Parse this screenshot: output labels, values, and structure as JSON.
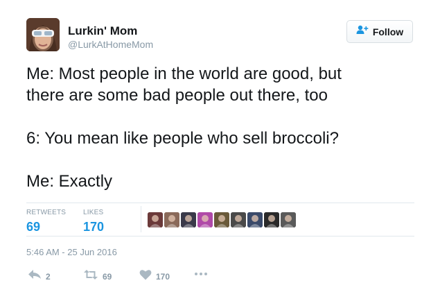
{
  "user": {
    "display_name": "Lurkin' Mom",
    "handle": "@LurkAtHomeMom"
  },
  "follow_button": {
    "label": "Follow",
    "icon": "add-user-icon"
  },
  "tweet": {
    "lines": [
      "Me: Most people in the world are good, but",
      "there are some bad people out there, too",
      "6: You mean like people who sell broccoli?",
      "Me: Exactly"
    ]
  },
  "stats": {
    "retweets_label": "RETWEETS",
    "retweets_value": "69",
    "likes_label": "LIKES",
    "likes_value": "170"
  },
  "likers": {
    "icon": "liker-avatar",
    "colors": [
      "#6b3a3a",
      "#8a6a5a",
      "#3a3a4a",
      "#b04aa8",
      "#6a5a3a",
      "#4a4a4a",
      "#3a4a6a",
      "#2a2a2a",
      "#5a5a5a"
    ]
  },
  "timestamp": "5:46 AM - 25 Jun 2016",
  "actions": {
    "reply_count": "2",
    "retweet_count": "69",
    "like_count": "170",
    "reply_icon": "reply-icon",
    "retweet_icon": "retweet-icon",
    "like_icon": "heart-icon",
    "more_icon": "more-icon"
  },
  "colors": {
    "accent": "#1b95e0",
    "muted": "#8899a6",
    "text": "#14171a",
    "divider": "#e1e8ed"
  }
}
